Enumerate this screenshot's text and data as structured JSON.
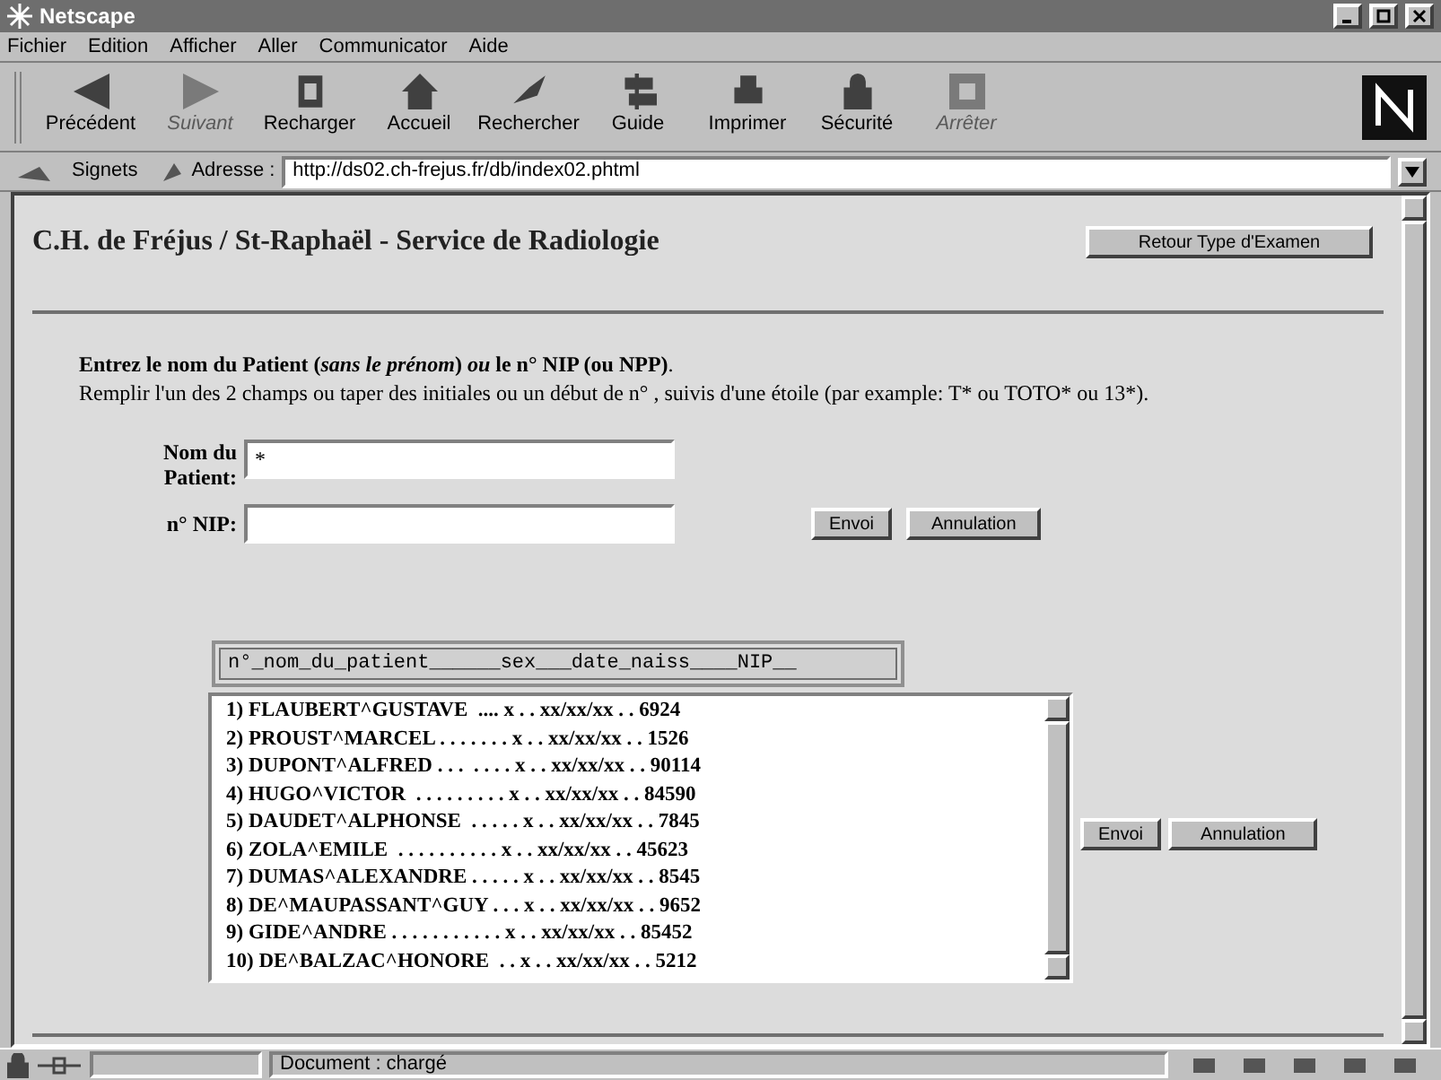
{
  "window": {
    "title": "Netscape"
  },
  "menu": [
    "Fichier",
    "Edition",
    "Afficher",
    "Aller",
    "Communicator",
    "Aide"
  ],
  "toolbar": [
    {
      "label": "Précédent",
      "disabled": false
    },
    {
      "label": "Suivant",
      "disabled": true
    },
    {
      "label": "Recharger",
      "disabled": false
    },
    {
      "label": "Accueil",
      "disabled": false
    },
    {
      "label": "Rechercher",
      "disabled": false
    },
    {
      "label": "Guide",
      "disabled": false
    },
    {
      "label": "Imprimer",
      "disabled": false
    },
    {
      "label": "Sécurité",
      "disabled": false
    },
    {
      "label": "Arrêter",
      "disabled": true
    }
  ],
  "location_bar": {
    "bookmarks": "Signets",
    "address_label": "Adresse :",
    "url": "http://ds02.ch-frejus.fr/db/index02.phtml"
  },
  "page": {
    "heading": "C.H. de Fréjus / St-Raphaël - Service de Radiologie",
    "back_button": "Retour Type d'Examen",
    "instruction": "Entrez le nom du Patient (*sans le prénom*) *ou* le n° NIP (ou NPP)",
    "instruction_end": ".",
    "hint": "Remplir l'un des 2 champs ou taper des initiales ou un début de n° , suivis d'une étoile (par example: T* ou TOTO* ou 13*).",
    "name_label_1": "Nom du",
    "name_label_2": "Patient:",
    "name_value": "*",
    "nip_label": "n° NIP:",
    "submit": "Envoi",
    "cancel": "Annulation",
    "list_header": "n°_nom_du_patient______sex___date_naiss____NIP__",
    "patients": [
      "1) FLAUBERT^GUSTAVE  .... x . . xx/xx/xx . . 6924",
      "2) PROUST^MARCEL . . . . . . . x . . xx/xx/xx . . 1526",
      "3) DUPONT^ALFRED . . .  . . . . x . . xx/xx/xx . . 90114",
      "4) HUGO^VICTOR  . . . . . . . . . x . . xx/xx/xx . . 84590",
      "5) DAUDET^ALPHONSE  . . . . . x . . xx/xx/xx . . 7845",
      "6) ZOLA^EMILE  . . . . . . . . . . x . . xx/xx/xx . . 45623",
      "7) DUMAS^ALEXANDRE . . . . . x . . xx/xx/xx . . 8545",
      "8) DE^MAUPASSANT^GUY . . . x . . xx/xx/xx . . 9652",
      "9) GIDE^ANDRE . . . . . . . . . . . x . . xx/xx/xx . . 85452",
      "10) DE^BALZAC^HONORE  . . x . . xx/xx/xx . . 5212"
    ],
    "submit_2": "Envoi",
    "cancel_2": "Annulation"
  },
  "status_bar": {
    "text": "Document : chargé"
  }
}
